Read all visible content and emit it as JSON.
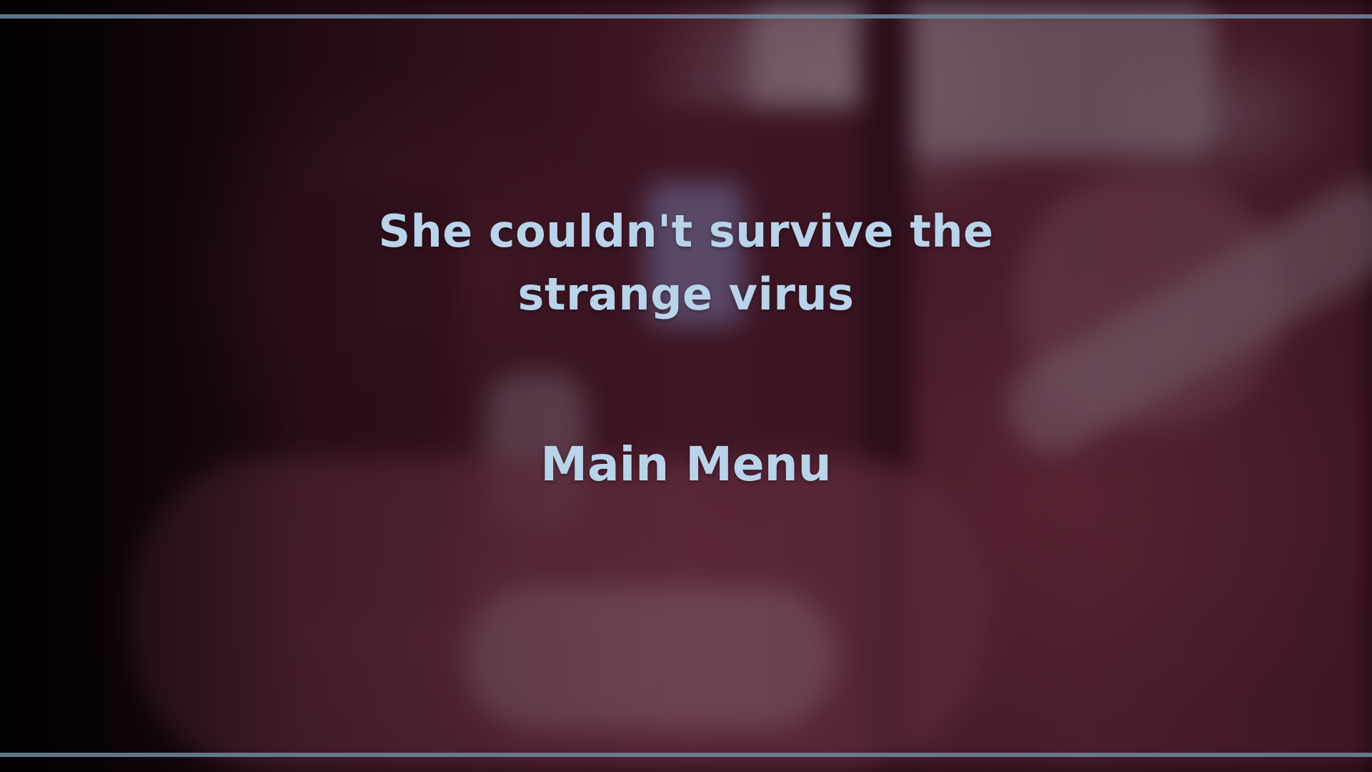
{
  "screen": {
    "message_line1": "She couldn't survive the",
    "message_line2": "strange virus",
    "main_menu_label": "Main Menu"
  },
  "colors": {
    "text": "#b9d3ea",
    "frame_line": "#6f8b9c",
    "background_tint": "#5c2232"
  }
}
